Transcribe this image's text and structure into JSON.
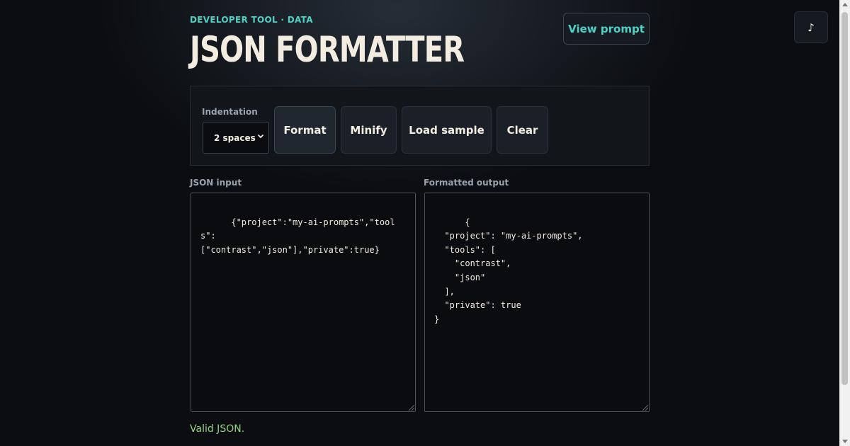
{
  "header": {
    "kicker": "DEVELOPER TOOL · DATA",
    "title": "JSON FORMATTER",
    "view_prompt_label": "View prompt",
    "music_icon": "♪"
  },
  "controls": {
    "indentation_label": "Indentation",
    "indentation_value": "2 spaces",
    "buttons": {
      "format": "Format",
      "minify": "Minify",
      "load_sample": "Load sample",
      "clear": "Clear"
    }
  },
  "input": {
    "label": "JSON input",
    "value": "{\"project\":\"my-ai-prompts\",\"tools\":\n[\"contrast\",\"json\"],\"private\":true}"
  },
  "output": {
    "label": "Formatted output",
    "value": "{\n  \"project\": \"my-ai-prompts\",\n  \"tools\": [\n    \"contrast\",\n    \"json\"\n  ],\n  \"private\": true\n}"
  },
  "status": {
    "message": "Valid JSON.",
    "color": "#8fd47e"
  },
  "theme": {
    "accent": "#4fd1c5",
    "background": "#0b0d11",
    "title_color": "#f3ece1"
  }
}
